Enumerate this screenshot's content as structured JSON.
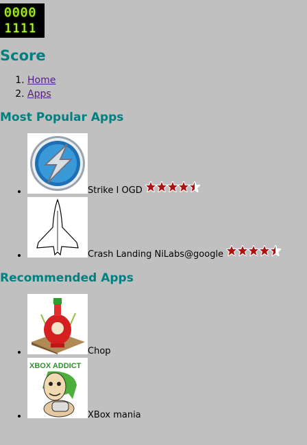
{
  "logo": {
    "line1": "0000",
    "line2": "1111"
  },
  "page_title": "Score",
  "breadcrumb": [
    {
      "label": "Home"
    },
    {
      "label": "Apps"
    }
  ],
  "sections": {
    "popular": {
      "title": "Most Popular Apps",
      "apps": [
        {
          "name": "Strike I OGD",
          "rating": 4.5,
          "icon": "strike-lightning-icon"
        },
        {
          "name": "Crash Landing NiLabs@google",
          "rating": 4.5,
          "icon": "space-shuttle-icon"
        }
      ]
    },
    "recommended": {
      "title": "Recommended Apps",
      "apps": [
        {
          "name": "Chop",
          "icon": "sriracha-bottle-icon"
        },
        {
          "name": "XBox mania",
          "icon": "xbox-addict-icon",
          "logo_text": "XBOX ADDICT"
        }
      ]
    }
  },
  "colors": {
    "background": "#c0c0c0",
    "heading": "#008080",
    "link": "#551a8b",
    "star": "#b01010",
    "logo_digits": "#b8ff1e"
  }
}
